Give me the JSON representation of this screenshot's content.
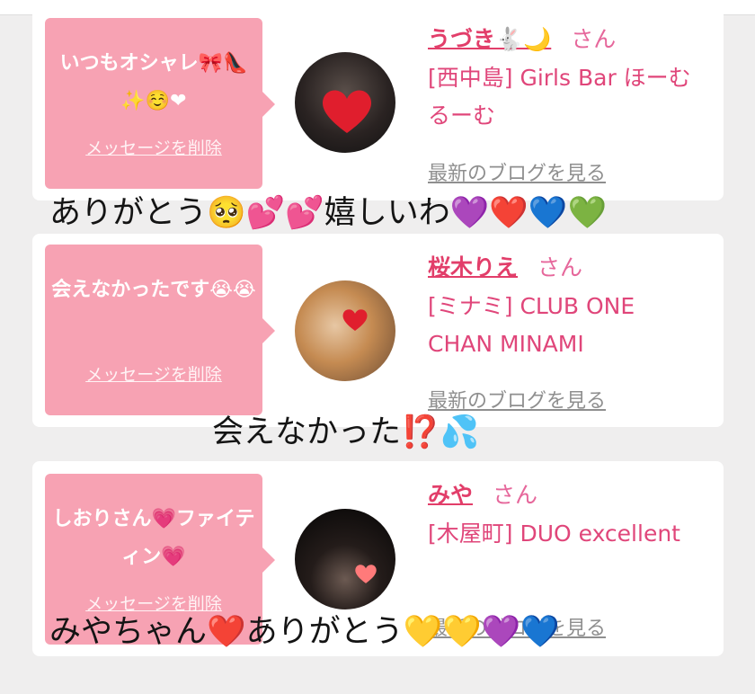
{
  "cards": [
    {
      "bubble_message": "いつもオシャレ🎀👠✨☺️❤",
      "delete_label": "メッセージを削除",
      "name": "うづき🐇🌙",
      "honorific": "さん",
      "shop": "[西中島] Girls Bar ほーむるーむ",
      "blog_link": "最新のブログを見る"
    },
    {
      "bubble_message": "会えなかったです😭😭",
      "delete_label": "メッセージを削除",
      "name": "桜木りえ",
      "honorific": "さん",
      "shop": "[ミナミ] CLUB ONE CHAN MINAMI",
      "blog_link": "最新のブログを見る"
    },
    {
      "bubble_message": "しおりさん💗ファイティン💗",
      "delete_label": "メッセージを削除",
      "name": "みや",
      "honorific": "さん",
      "shop": "[木屋町] DUO excellent",
      "blog_link": "最新のブログを見る"
    }
  ],
  "overlays": [
    "ありがとう🥺💕💕嬉しいわ💜❤️💙💚",
    "会えなかった⁉️💦",
    "みやちゃん❤️ありがとう💛💛💜💙"
  ],
  "colors": {
    "bubble": "#f7a2b3",
    "name": "#e23e6a",
    "shop": "#e0467a",
    "background": "#efeeee"
  }
}
